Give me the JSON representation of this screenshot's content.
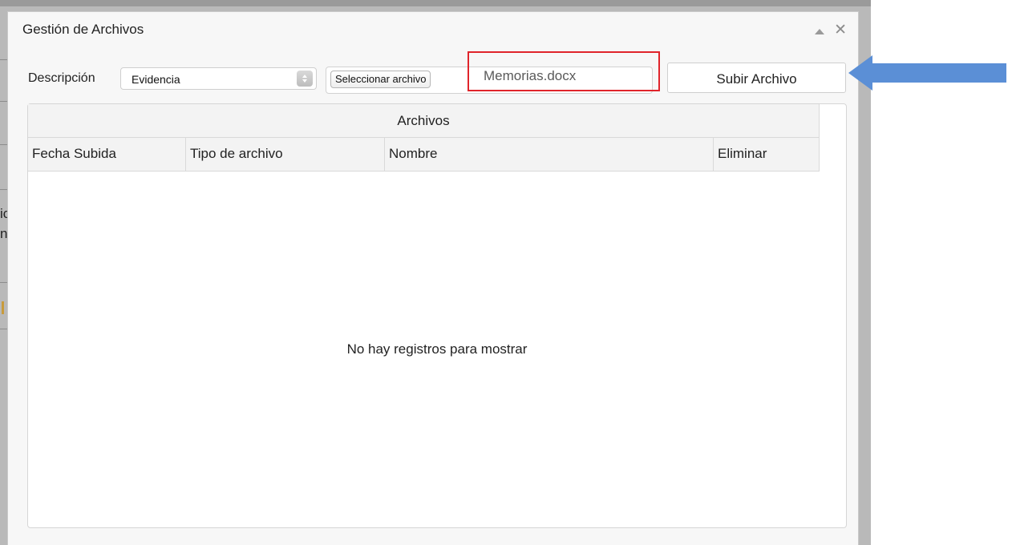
{
  "dialog": {
    "title": "Gestión de Archivos"
  },
  "backdrop": {
    "fragment_1": "ic",
    "fragment_2": "n"
  },
  "toolbar": {
    "description_label": "Descripción",
    "description_value": "Evidencia",
    "file_button_label": "Seleccionar archivo",
    "file_name": "Memorias.docx",
    "upload_button_label": "Subir Archivo"
  },
  "table": {
    "caption": "Archivos",
    "columns": [
      "Fecha Subida",
      "Tipo de archivo",
      "Nombre",
      "Eliminar"
    ],
    "rows": [],
    "empty_message": "No hay registros para mostrar"
  },
  "colors": {
    "highlight": "#e0242b",
    "annotation_arrow": "#5b8fd6"
  },
  "icons": {
    "collapse": "triangle-up-icon",
    "close": "close-icon",
    "select_arrows": "select-arrows-icon",
    "annotation": "arrow-left-icon"
  }
}
